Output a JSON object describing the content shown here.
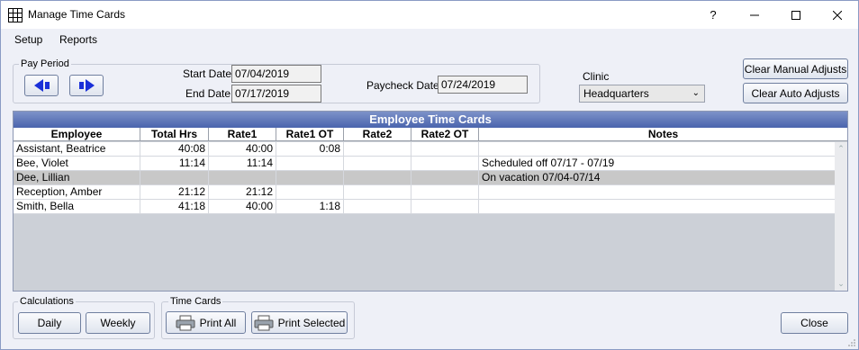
{
  "window": {
    "title": "Manage Time Cards",
    "help_label": "?",
    "minimize_label": "—",
    "maximize_label": "☐",
    "close_label": "✕"
  },
  "menu": [
    "Setup",
    "Reports"
  ],
  "pay_period": {
    "group_label": "Pay Period",
    "start_label": "Start Date",
    "start_value": "07/04/2019",
    "end_label": "End Date",
    "end_value": "07/17/2019",
    "paycheck_label": "Paycheck Date",
    "paycheck_value": "07/24/2019"
  },
  "clinic": {
    "label": "Clinic",
    "selected": "Headquarters"
  },
  "actions": {
    "clear_manual": "Clear Manual Adjusts",
    "clear_auto": "Clear Auto Adjusts"
  },
  "grid": {
    "caption": "Employee Time Cards",
    "columns": [
      "Employee",
      "Total Hrs",
      "Rate1",
      "Rate1 OT",
      "Rate2",
      "Rate2 OT",
      "Notes"
    ],
    "rows": [
      {
        "employee": "Assistant, Beatrice",
        "total": "40:08",
        "rate1": "40:00",
        "rate1ot": "0:08",
        "rate2": "",
        "rate2ot": "",
        "notes": ""
      },
      {
        "employee": "Bee, Violet",
        "total": "11:14",
        "rate1": "11:14",
        "rate1ot": "",
        "rate2": "",
        "rate2ot": "",
        "notes": "Scheduled off 07/17 - 07/19"
      },
      {
        "employee": "Dee, Lillian",
        "total": "",
        "rate1": "",
        "rate1ot": "",
        "rate2": "",
        "rate2ot": "",
        "notes": "On vacation 07/04-07/14"
      },
      {
        "employee": "Reception, Amber",
        "total": "21:12",
        "rate1": "21:12",
        "rate1ot": "",
        "rate2": "",
        "rate2ot": "",
        "notes": ""
      },
      {
        "employee": "Smith, Bella",
        "total": "41:18",
        "rate1": "40:00",
        "rate1ot": "1:18",
        "rate2": "",
        "rate2ot": "",
        "notes": ""
      }
    ]
  },
  "calculations": {
    "group_label": "Calculations",
    "daily": "Daily",
    "weekly": "Weekly"
  },
  "time_cards": {
    "group_label": "Time Cards",
    "print_all": "Print All",
    "print_selected": "Print Selected"
  },
  "close_button": "Close",
  "colors": {
    "grid_header": "#4a64ad",
    "arrow": "#1a30d8",
    "selected_row": "#c8c8c8"
  }
}
